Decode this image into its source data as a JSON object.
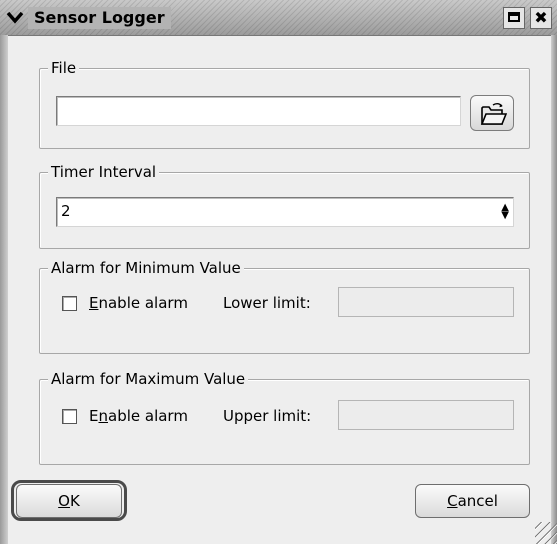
{
  "window": {
    "title": "Sensor Logger",
    "menu_glyph": "❯",
    "close_glyph": "✖"
  },
  "file_group": {
    "label": "File",
    "path_value": ""
  },
  "timer_group": {
    "label": "Timer Interval",
    "value": "2"
  },
  "min_alarm_group": {
    "label": "Alarm for Minimum Value",
    "enable_accel": "E",
    "enable_rest": "nable alarm",
    "enabled": false,
    "limit_label": "Lower limit:",
    "limit_value": ""
  },
  "max_alarm_group": {
    "label": "Alarm for Maximum Value",
    "enable_pre": "E",
    "enable_accel": "n",
    "enable_rest": "able alarm",
    "enabled": false,
    "limit_label": "Upper limit:",
    "limit_value": ""
  },
  "buttons": {
    "ok_accel": "O",
    "ok_rest": "K",
    "cancel_accel": "C",
    "cancel_rest": "ancel"
  }
}
